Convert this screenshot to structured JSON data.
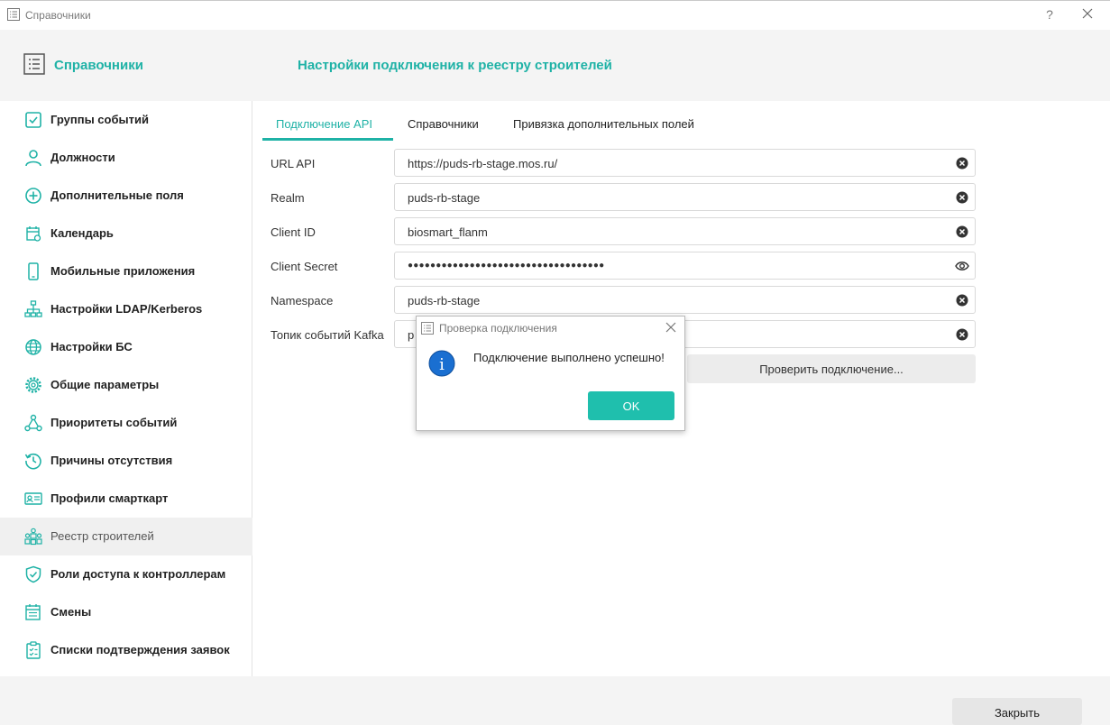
{
  "window": {
    "title": "Справочники",
    "help_label": "?"
  },
  "header": {
    "app_title": "Справочники",
    "page_title": "Настройки подключения к реестру строителей"
  },
  "sidebar": {
    "items": [
      {
        "label": "Группы событий",
        "icon": "checkbox-icon"
      },
      {
        "label": "Должности",
        "icon": "person-icon"
      },
      {
        "label": "Дополнительные поля",
        "icon": "plus-circle-icon"
      },
      {
        "label": "Календарь",
        "icon": "calendar-icon"
      },
      {
        "label": "Мобильные приложения",
        "icon": "mobile-phone-icon"
      },
      {
        "label": "Настройки LDAP/Kerberos",
        "icon": "network-tree-icon"
      },
      {
        "label": "Настройки БС",
        "icon": "globe-icon"
      },
      {
        "label": "Общие параметры",
        "icon": "gear-icon"
      },
      {
        "label": "Приоритеты событий",
        "icon": "hierarchy-icon"
      },
      {
        "label": "Причины отсутствия",
        "icon": "history-icon"
      },
      {
        "label": "Профили смарткарт",
        "icon": "id-card-icon"
      },
      {
        "label": "Реестр строителей",
        "icon": "builders-icon",
        "active": true
      },
      {
        "label": "Роли доступа к контроллерам",
        "icon": "shield-check-icon"
      },
      {
        "label": "Смены",
        "icon": "shift-calendar-icon"
      },
      {
        "label": "Списки подтверждения заявок",
        "icon": "clipboard-check-icon"
      }
    ]
  },
  "tabs": [
    {
      "label": "Подключение API",
      "active": true
    },
    {
      "label": "Справочники"
    },
    {
      "label": "Привязка дополнительных полей"
    }
  ],
  "form": {
    "fields": [
      {
        "label": "URL API",
        "value": "https://puds-rb-stage.mos.ru/"
      },
      {
        "label": "Realm",
        "value": "puds-rb-stage"
      },
      {
        "label": "Client ID",
        "value": "biosmart_flanm"
      },
      {
        "label": "Client Secret",
        "value": "●●●●●●●●●●●●●●●●●●●●●●●●●●●●●●●●●●●"
      },
      {
        "label": "Namespace",
        "value": "puds-rb-stage"
      },
      {
        "label": "Топик событий Kafka",
        "value": "p"
      }
    ],
    "check_button_label": "Проверить подключение..."
  },
  "footer": {
    "close_label": "Закрыть"
  },
  "dialog": {
    "title": "Проверка подключения",
    "message": "Подключение выполнено успешно!",
    "ok_label": "OK",
    "info_glyph": "i"
  },
  "colors": {
    "accent": "#1fb2a6",
    "ok_button": "#1fbfad",
    "info": "#1a6fd1"
  }
}
